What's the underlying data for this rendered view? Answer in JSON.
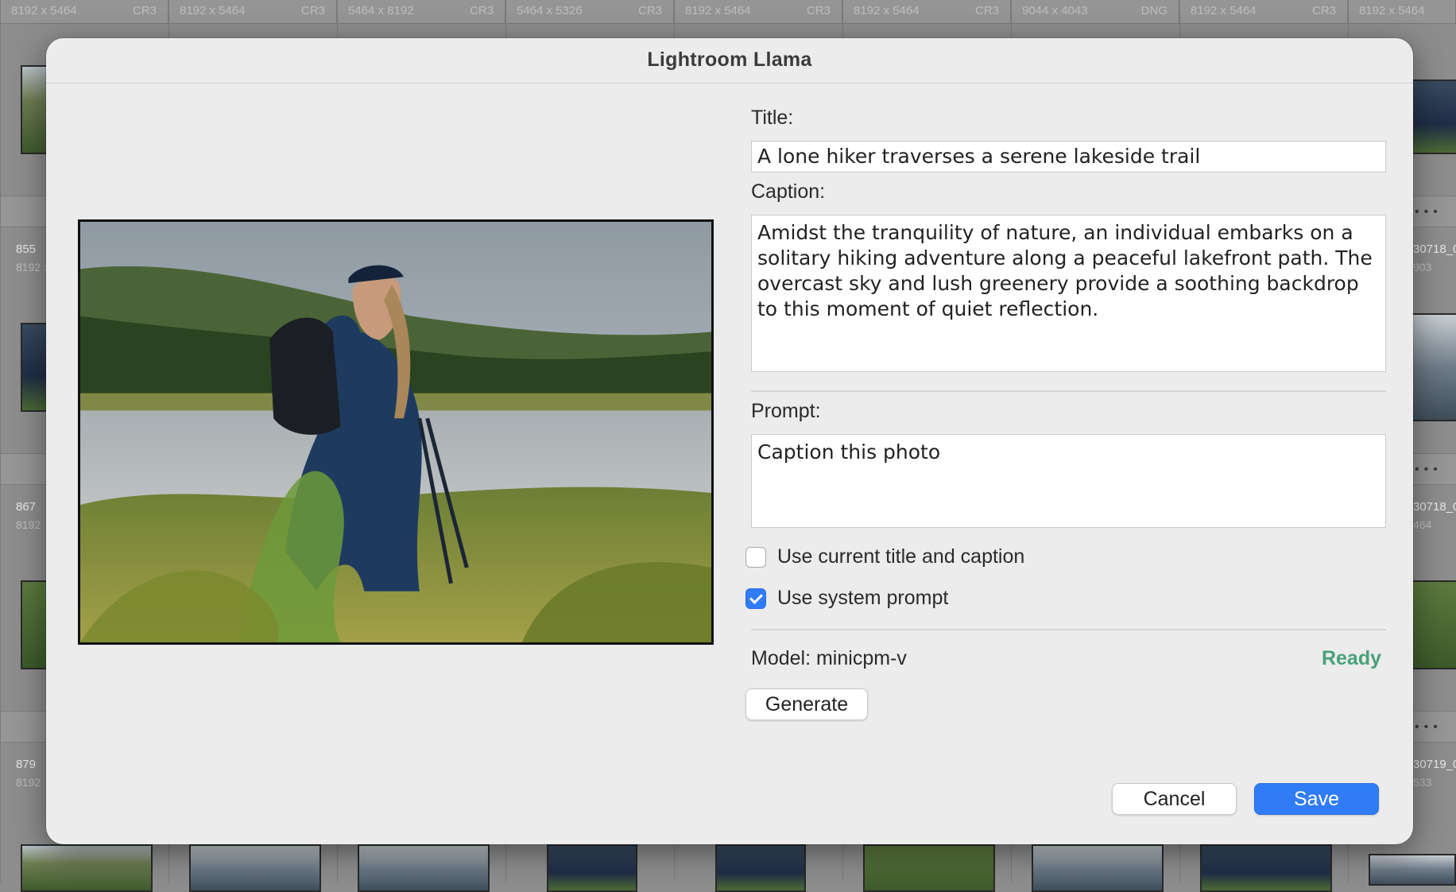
{
  "background": {
    "header_cells": [
      {
        "dim": "8192 x 5464",
        "ext": "CR3"
      },
      {
        "dim": "8192 x 5464",
        "ext": "CR3"
      },
      {
        "dim": "5464 x 8192",
        "ext": "CR3"
      },
      {
        "dim": "5464 x 5326",
        "ext": "CR3"
      },
      {
        "dim": "8192 x 5464",
        "ext": "CR3"
      },
      {
        "dim": "8192 x 5464",
        "ext": "CR3"
      },
      {
        "dim": "9044 x 4043",
        "ext": "DNG"
      },
      {
        "dim": "8192 x 5464",
        "ext": "CR3"
      },
      {
        "dim": "8192 x 5464",
        "ext": ""
      }
    ],
    "rows": [
      {
        "num": "855",
        "sub": "8192 :",
        "right_label": "30718_0",
        "right_sub": "903"
      },
      {
        "num": "867",
        "sub": "8192",
        "right_label": "30718_0",
        "right_sub": "464"
      },
      {
        "num": "879",
        "sub": "8192",
        "right_label": "30719_0",
        "right_sub": "533"
      }
    ]
  },
  "dialog": {
    "title": "Lightroom Llama",
    "title_label": "Title:",
    "title_value": "A lone hiker traverses a serene lakeside trail",
    "caption_label": "Caption:",
    "caption_value": "Amidst the tranquility of nature, an individual embarks on a solitary hiking adventure along a peaceful lakefront path. The overcast sky and lush greenery provide a soothing backdrop to this moment of quiet reflection.",
    "prompt_label": "Prompt:",
    "prompt_value": "Caption this photo",
    "use_current_label": "Use current title and caption",
    "use_current_checked": false,
    "use_system_label": "Use system prompt",
    "use_system_checked": true,
    "model_label": "Model: minicpm-v",
    "status": "Ready",
    "generate_label": "Generate",
    "cancel_label": "Cancel",
    "save_label": "Save"
  },
  "colors": {
    "accent": "#2f7cf6",
    "status_ready": "#4aa07a",
    "dialog_bg": "#ececec"
  }
}
